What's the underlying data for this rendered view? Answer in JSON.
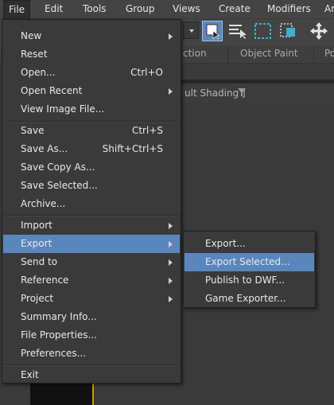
{
  "menubar": {
    "items": [
      "File",
      "Edit",
      "Tools",
      "Group",
      "Views",
      "Create",
      "Modifiers",
      "Ar"
    ]
  },
  "toolbar": {
    "ribbon_labels": [
      "ction",
      "Object Paint",
      "Po"
    ],
    "icons": [
      "dropdown-arrow-icon",
      "select-object-icon",
      "select-by-name-icon",
      "rectangular-selection-icon",
      "window-crossing-icon",
      "move-icon"
    ]
  },
  "viewport": {
    "label": "ult Shading ]",
    "filter_icon": "filter-icon"
  },
  "file_menu": {
    "items": [
      {
        "label": "New",
        "shortcut": "",
        "submenu": true
      },
      {
        "label": "Reset",
        "shortcut": "",
        "submenu": false
      },
      {
        "label": "Open...",
        "shortcut": "Ctrl+O",
        "submenu": false
      },
      {
        "label": "Open Recent",
        "shortcut": "",
        "submenu": true
      },
      {
        "label": "View Image File...",
        "shortcut": "",
        "submenu": false
      },
      {
        "label": "Save",
        "shortcut": "Ctrl+S",
        "submenu": false
      },
      {
        "label": "Save As...",
        "shortcut": "Shift+Ctrl+S",
        "submenu": false
      },
      {
        "label": "Save Copy As...",
        "shortcut": "",
        "submenu": false
      },
      {
        "label": "Save Selected...",
        "shortcut": "",
        "submenu": false
      },
      {
        "label": "Archive...",
        "shortcut": "",
        "submenu": false
      },
      {
        "label": "Import",
        "shortcut": "",
        "submenu": true
      },
      {
        "label": "Export",
        "shortcut": "",
        "submenu": true,
        "highlighted": true
      },
      {
        "label": "Send to",
        "shortcut": "",
        "submenu": true
      },
      {
        "label": "Reference",
        "shortcut": "",
        "submenu": true
      },
      {
        "label": "Project",
        "shortcut": "",
        "submenu": true
      },
      {
        "label": "Summary Info...",
        "shortcut": "",
        "submenu": false
      },
      {
        "label": "File Properties...",
        "shortcut": "",
        "submenu": false
      },
      {
        "label": "Preferences...",
        "shortcut": "",
        "submenu": false
      },
      {
        "label": "Exit",
        "shortcut": "",
        "submenu": false
      }
    ]
  },
  "export_submenu": {
    "items": [
      {
        "label": "Export..."
      },
      {
        "label": "Export Selected...",
        "highlighted": true
      },
      {
        "label": "Publish to DWF..."
      },
      {
        "label": "Game Exporter..."
      }
    ]
  },
  "colors": {
    "highlight": "#5a86be",
    "menu_bg": "#3a3a3a",
    "app_bg": "#444444",
    "viewport_border": "#c9a000"
  }
}
